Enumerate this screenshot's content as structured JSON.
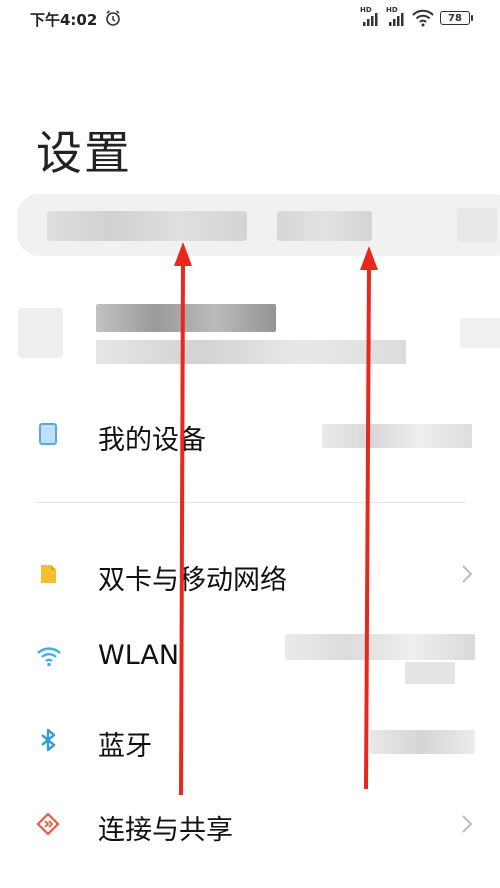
{
  "status_bar": {
    "time": "下午4:02",
    "signal1_tag": "HD",
    "signal2_tag": "HD",
    "battery": "78",
    "icons": [
      "alarm-icon",
      "signal-icon",
      "signal-icon",
      "wifi-icon",
      "battery-icon"
    ]
  },
  "page": {
    "title": "设置"
  },
  "search": {
    "value": ""
  },
  "menu": {
    "my_device": {
      "label": "我的设备",
      "icon": "tablet-icon",
      "icon_color": "#5aa8e6"
    },
    "sim": {
      "label": "双卡与移动网络",
      "icon": "sim-card-icon",
      "icon_color": "#f5c030"
    },
    "wlan": {
      "label": "WLAN",
      "icon": "wifi-icon",
      "icon_color": "#3db0e6"
    },
    "bluetooth": {
      "label": "蓝牙",
      "icon": "bluetooth-icon",
      "icon_color": "#2f9ad8"
    },
    "connection": {
      "label": "连接与共享",
      "icon": "share-icon",
      "icon_color": "#e85a44"
    }
  },
  "annotations": {
    "arrow_color": "#e8281e"
  }
}
